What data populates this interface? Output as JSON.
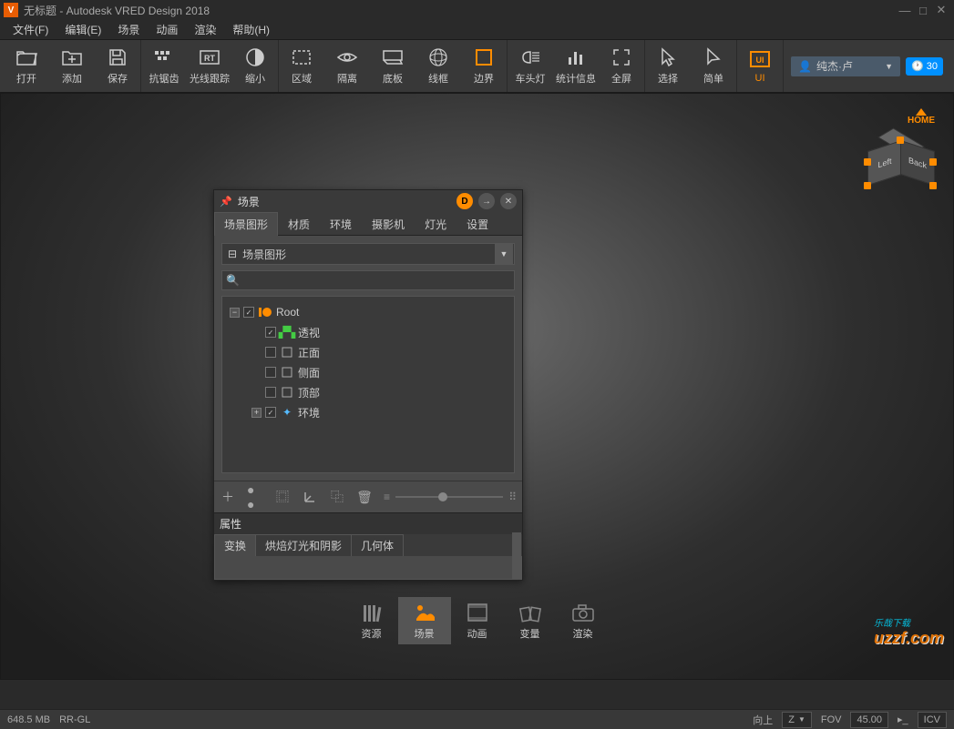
{
  "title": "无标题 - Autodesk VRED Design 2018",
  "menu": [
    "文件(F)",
    "编辑(E)",
    "场景",
    "动画",
    "渲染",
    "帮助(H)"
  ],
  "toolbar": {
    "open": "打开",
    "add": "添加",
    "save": "保存",
    "antialias": "抗锯齿",
    "raytrace": "光线跟踪",
    "zoomout": "缩小",
    "region": "区域",
    "isolate": "隔离",
    "floor": "底板",
    "wire": "线框",
    "boundary": "边界",
    "headlight": "车头灯",
    "stats": "统计信息",
    "fullscreen": "全屏",
    "select": "选择",
    "simple": "简单"
  },
  "user": {
    "name": "纯杰·卢",
    "days": "30"
  },
  "viewcube": {
    "home": "HOME",
    "left": "Left",
    "back": "Back"
  },
  "panel": {
    "title": "场景",
    "tabs": [
      "场景图形",
      "材质",
      "环境",
      "摄影机",
      "灯光",
      "设置"
    ],
    "combo": "场景图形",
    "tree": {
      "root": "Root",
      "nodes": [
        "透视",
        "正面",
        "侧面",
        "顶部",
        "环境"
      ]
    },
    "props": {
      "header": "属性",
      "tabs": [
        "变换",
        "烘焙灯光和阴影",
        "几何体"
      ]
    }
  },
  "assetbar": [
    "资源",
    "场景",
    "动画",
    "变量",
    "渲染"
  ],
  "status": {
    "mem": "648.5 MB",
    "render": "RR-GL",
    "up": "向上",
    "axis": "Z",
    "fov_lbl": "FOV",
    "fov": "45.00",
    "icv": "ICV"
  },
  "watermark": {
    "line1": "乐哉下载",
    "line2": "uzzf.com"
  }
}
